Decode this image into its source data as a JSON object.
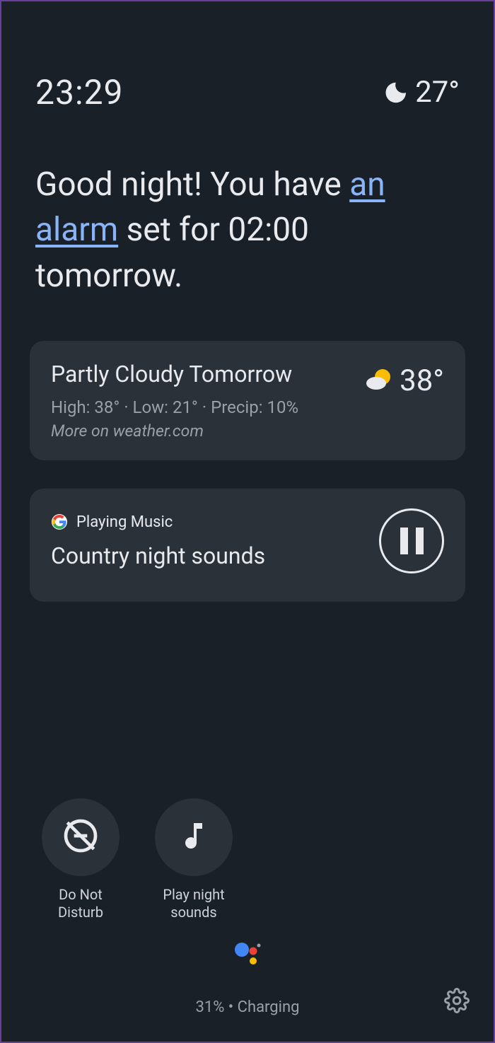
{
  "header": {
    "time": "23:29",
    "temp": "27°",
    "icon": "moon-icon"
  },
  "greeting": {
    "prefix": "Good night! You have ",
    "alarm_link": "an alarm",
    "suffix": " set for 02:00 tomorrow."
  },
  "weather_card": {
    "title": "Partly Cloudy Tomorrow",
    "detail": "High: 38° · Low: 21° · Precip: 10%",
    "more": "More on weather.com",
    "temp": "38°",
    "icon": "partly-cloudy-icon"
  },
  "music_card": {
    "source_label": "Playing Music",
    "title": "Country night sounds",
    "control_icon": "pause-icon"
  },
  "quick_actions": [
    {
      "icon": "dnd-off-icon",
      "label": "Do Not\nDisturb"
    },
    {
      "icon": "music-note-icon",
      "label": "Play night\nsounds"
    }
  ],
  "footer": {
    "status": "31% • Charging"
  }
}
